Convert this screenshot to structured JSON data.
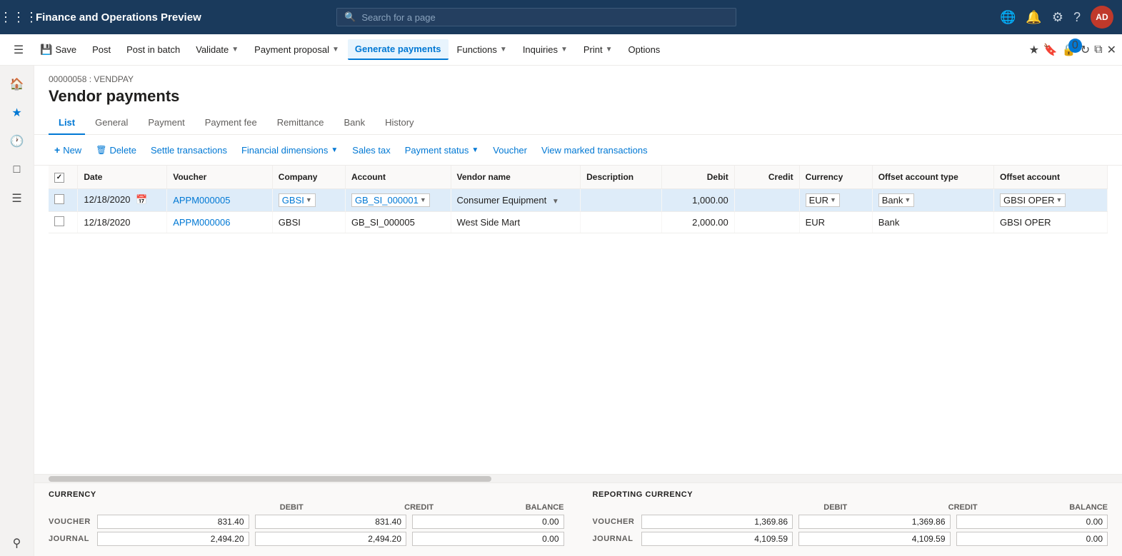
{
  "app": {
    "title": "Finance and Operations Preview"
  },
  "search": {
    "placeholder": "Search for a page"
  },
  "topRightIcons": {
    "notifications": "🔔",
    "settings": "⚙",
    "help": "?",
    "userInitials": "AD"
  },
  "commandBar": {
    "save": "Save",
    "post": "Post",
    "postInBatch": "Post in batch",
    "validate": "Validate",
    "paymentProposal": "Payment proposal",
    "generatePayments": "Generate payments",
    "functions": "Functions",
    "inquiries": "Inquiries",
    "print": "Print",
    "options": "Options"
  },
  "breadcrumb": "00000058 : VENDPAY",
  "pageTitle": "Vendor payments",
  "tabs": [
    "List",
    "General",
    "Payment",
    "Payment fee",
    "Remittance",
    "Bank",
    "History"
  ],
  "activeTab": "List",
  "toolbar": {
    "new": "+ New",
    "delete": "Delete",
    "settleTransactions": "Settle transactions",
    "financialDimensions": "Financial dimensions",
    "salesTax": "Sales tax",
    "paymentStatus": "Payment status",
    "voucher": "Voucher",
    "viewMarkedTransactions": "View marked transactions"
  },
  "tableHeaders": {
    "checkbox": "",
    "date": "Date",
    "voucher": "Voucher",
    "company": "Company",
    "account": "Account",
    "vendorName": "Vendor name",
    "description": "Description",
    "debit": "Debit",
    "credit": "Credit",
    "currency": "Currency",
    "offsetAccountType": "Offset account type",
    "offsetAccount": "Offset account"
  },
  "tableRows": [
    {
      "selected": true,
      "date": "12/18/2020",
      "voucher": "APPM000005",
      "company": "GBSI",
      "account": "GB_SI_000001",
      "vendorName": "Consumer Equipment",
      "description": "",
      "debit": "1,000.00",
      "credit": "",
      "currency": "EUR",
      "offsetAccountType": "Bank",
      "offsetAccount": "GBSI OPER"
    },
    {
      "selected": false,
      "date": "12/18/2020",
      "voucher": "APPM000006",
      "company": "GBSI",
      "account": "GB_SI_000005",
      "vendorName": "West Side Mart",
      "description": "",
      "debit": "2,000.00",
      "credit": "",
      "currency": "EUR",
      "offsetAccountType": "Bank",
      "offsetAccount": "GBSI OPER"
    }
  ],
  "summary": {
    "currency": {
      "title": "CURRENCY",
      "debitLabel": "DEBIT",
      "creditLabel": "CREDIT",
      "balanceLabel": "BALANCE",
      "voucherLabel": "VOUCHER",
      "journalLabel": "JOURNAL",
      "voucher": {
        "debit": "831.40",
        "credit": "831.40",
        "balance": "0.00"
      },
      "journal": {
        "debit": "2,494.20",
        "credit": "2,494.20",
        "balance": "0.00"
      }
    },
    "reportingCurrency": {
      "title": "REPORTING CURRENCY",
      "debitLabel": "DEBIT",
      "creditLabel": "CREDIT",
      "balanceLabel": "BALANCE",
      "voucherLabel": "VOUCHER",
      "journalLabel": "JOURNAL",
      "voucher": {
        "debit": "1,369.86",
        "credit": "1,369.86",
        "balance": "0.00"
      },
      "journal": {
        "debit": "4,109.59",
        "credit": "4,109.59",
        "balance": "0.00"
      }
    }
  }
}
